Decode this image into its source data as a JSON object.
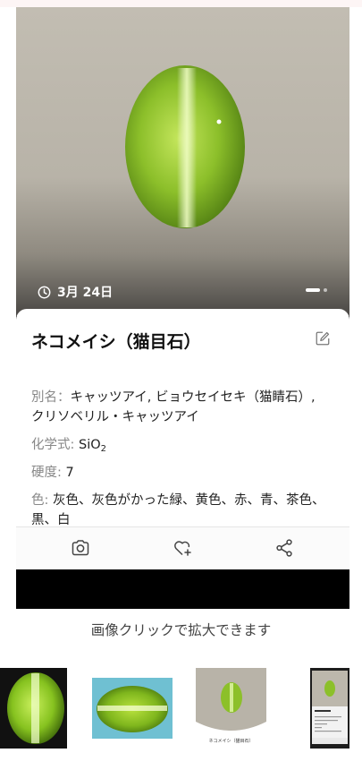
{
  "phone": {
    "date": "3月 24日",
    "title": "ネコメイシ（猫目石）",
    "fields": [
      {
        "label": "別名：",
        "value": "キャッツアイ, ビョウセイセキ（猫睛石）, クリソベリル・キャッツアイ"
      },
      {
        "label": "化学式:",
        "value_prefix": "SiO",
        "value_sub": "2"
      },
      {
        "label": "硬度:",
        "value": "7"
      },
      {
        "label": "色:",
        "value": "灰色、灰色がかった緑、黄色、赤、青、茶色、黒、白"
      }
    ],
    "icons": {
      "edit": "edit-icon",
      "camera": "camera-icon",
      "favorite": "heart-plus-icon",
      "share": "share-icon",
      "clock": "clock-icon"
    }
  },
  "caption": "画像クリックで拡大できます",
  "thumbnails": {
    "t3_caption": "ネコメイシ（猫目石）"
  },
  "colors": {
    "gem_green": "#8fc12e",
    "background_gray": "#bcb7ac"
  }
}
